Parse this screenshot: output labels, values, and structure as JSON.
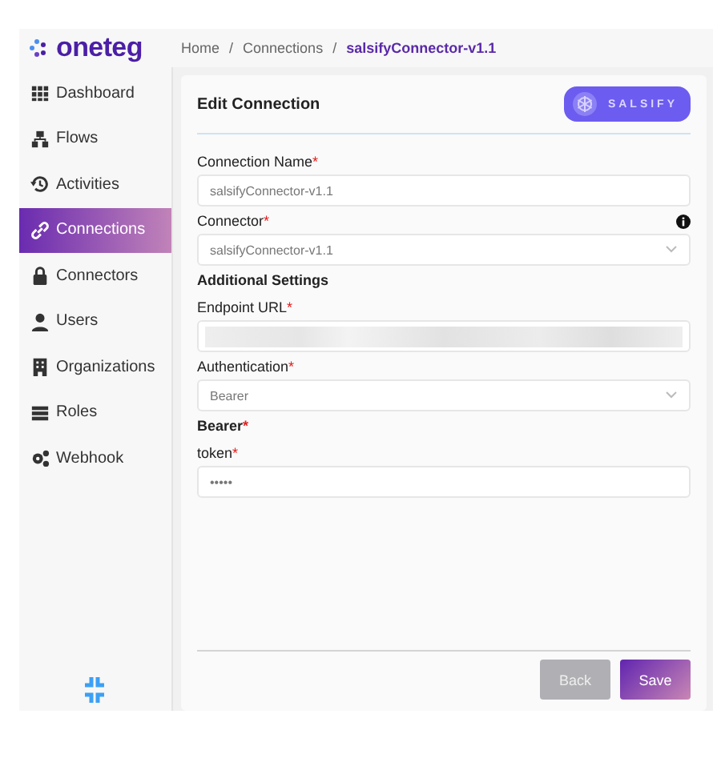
{
  "logo": {
    "text": "oneteg"
  },
  "breadcrumb": {
    "separator": "/",
    "items": [
      "Home",
      "Connections",
      "salsifyConnector-v1.1"
    ]
  },
  "required_mark": "*",
  "sidebar": {
    "items": [
      {
        "label": "Dashboard",
        "selected": false
      },
      {
        "label": "Flows",
        "selected": false
      },
      {
        "label": "Activities",
        "selected": false
      },
      {
        "label": "Connections",
        "selected": true
      },
      {
        "label": "Connectors",
        "selected": false
      },
      {
        "label": "Users",
        "selected": false
      },
      {
        "label": "Organizations",
        "selected": false
      },
      {
        "label": "Roles",
        "selected": false
      },
      {
        "label": "Webhook",
        "selected": false
      }
    ]
  },
  "card": {
    "title": "Edit Connection",
    "brand": "SALSIFY",
    "fields": [
      {
        "kind": "text",
        "label": "Connection Name",
        "required": true,
        "value": "salsifyConnector-v1.1"
      },
      {
        "kind": "select",
        "label": "Connector",
        "required": true,
        "info": true,
        "value": "salsifyConnector-v1.1"
      },
      {
        "kind": "heading",
        "label": "Additional Settings",
        "required": false
      },
      {
        "kind": "redacted",
        "label": "Endpoint URL",
        "required": true
      },
      {
        "kind": "select",
        "label": "Authentication",
        "required": true,
        "value": "Bearer"
      },
      {
        "kind": "heading",
        "label": "Bearer",
        "required": true
      },
      {
        "kind": "text",
        "label": "token",
        "required": true,
        "value": "•••••"
      }
    ],
    "buttons": [
      {
        "label": "Back",
        "kind": "secondary"
      },
      {
        "label": "Save",
        "kind": "primary"
      }
    ]
  }
}
